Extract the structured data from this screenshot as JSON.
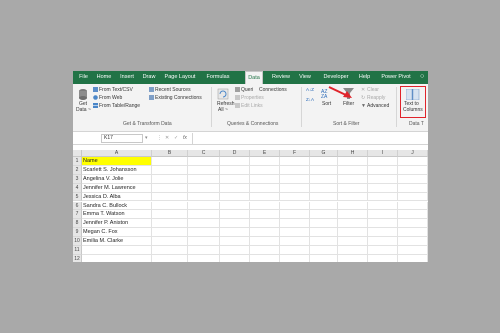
{
  "tabs": [
    "File",
    "Home",
    "Insert",
    "Draw",
    "Page Layout",
    "Formulas",
    "Data",
    "Review",
    "View",
    "Developer",
    "Help",
    "Power Pivot"
  ],
  "active_tab": "Data",
  "ribbon": {
    "get_data": [
      "Get",
      "Data ~"
    ],
    "from_text_csv": "From Text/CSV",
    "from_web": "From Web",
    "from_table_range": "From Table/Range",
    "recent_sources": "Recent Sources",
    "existing_connections": "Existing Connections",
    "group_get_transform": "Get & Transform Data",
    "refresh_all": [
      "Refresh",
      "All ~"
    ],
    "queries": "Queri",
    "connections": "Connections",
    "properties": "Properties",
    "edit_links": "Edit Links",
    "group_queries": "Queries & Connections",
    "sort": "Sort",
    "filter": "Filter",
    "clear": "Clear",
    "reapply": "Reapply",
    "advanced": "Advanced",
    "group_sort_filter": "Sort & Filter",
    "text_to_columns": [
      "Text to",
      "Columns"
    ],
    "group_data_tools": "Data T"
  },
  "formula_bar": {
    "name_box": "K17",
    "fx": "fx"
  },
  "columns": [
    "A",
    "B",
    "C",
    "D",
    "E",
    "F",
    "G",
    "H",
    "I",
    "J",
    "K"
  ],
  "rows": [
    "1",
    "2",
    "3",
    "4",
    "5",
    "6",
    "7",
    "8",
    "9",
    "10",
    "11",
    "12"
  ],
  "column_a": [
    "Name",
    "Scarlett S. Johansson",
    "Angelina V. Jolie",
    "Jennifer M. Lawrence",
    "Jessica D. Alba",
    "Sandra C. Bullock",
    "Emma T. Watson",
    "Jennifer P. Aniston",
    "Megan C. Fox",
    "Emilia M. Clarke",
    "",
    ""
  ],
  "colors": {
    "excel_green": "#217346",
    "highlight": "#ffff00",
    "annotation_red": "#e0242b",
    "backdrop": "#a9a9a9"
  }
}
